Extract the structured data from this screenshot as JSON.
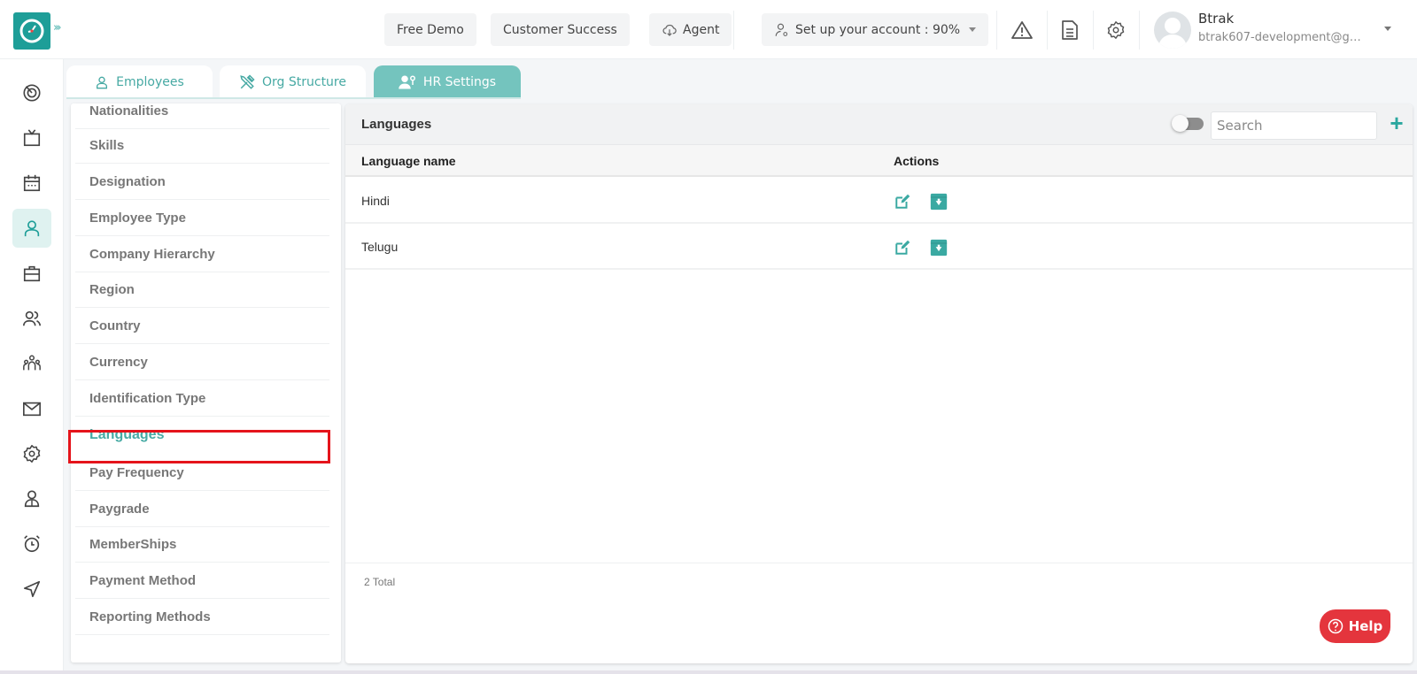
{
  "header": {
    "buttons": {
      "free_demo": "Free Demo",
      "customer_success": "Customer Success",
      "agent": "Agent",
      "setup_account": "Set up your account : 90%"
    },
    "user": {
      "name": "Btrak",
      "email": "btrak607-development@gm..."
    }
  },
  "tabs": [
    {
      "label": "Employees",
      "icon": "user-icon",
      "active": false
    },
    {
      "label": "Org Structure",
      "icon": "tools-icon",
      "active": false
    },
    {
      "label": "HR Settings",
      "icon": "user-settings-icon",
      "active": true
    }
  ],
  "leftnav": [
    {
      "icon": "dashboard-icon"
    },
    {
      "icon": "tv-icon"
    },
    {
      "icon": "calendar-icon"
    },
    {
      "icon": "user-icon",
      "active": true
    },
    {
      "icon": "briefcase-icon"
    },
    {
      "icon": "users-icon"
    },
    {
      "icon": "team-icon"
    },
    {
      "icon": "mail-icon"
    },
    {
      "icon": "settings-icon"
    },
    {
      "icon": "person-badge-icon"
    },
    {
      "icon": "alarm-icon"
    },
    {
      "icon": "send-icon"
    }
  ],
  "settings_menu": [
    "Nationalities",
    "Skills",
    "Designation",
    "Employee Type",
    "Company Hierarchy",
    "Region",
    "Country",
    "Currency",
    "Identification Type",
    "Languages",
    "Pay Frequency",
    "Paygrade",
    "MemberShips",
    "Payment Method",
    "Reporting Methods"
  ],
  "settings_active": "Languages",
  "panel": {
    "title": "Languages",
    "search_placeholder": "Search",
    "add_label": "+",
    "columns": [
      "Language name",
      "Actions"
    ],
    "rows": [
      {
        "name": "Hindi"
      },
      {
        "name": "Telugu"
      }
    ],
    "total": "2 Total"
  },
  "help_label": "Help",
  "colors": {
    "brand": "#1e9e98",
    "accent": "#46aaa4",
    "highlight": "#e5141b",
    "help": "#e4353d"
  }
}
